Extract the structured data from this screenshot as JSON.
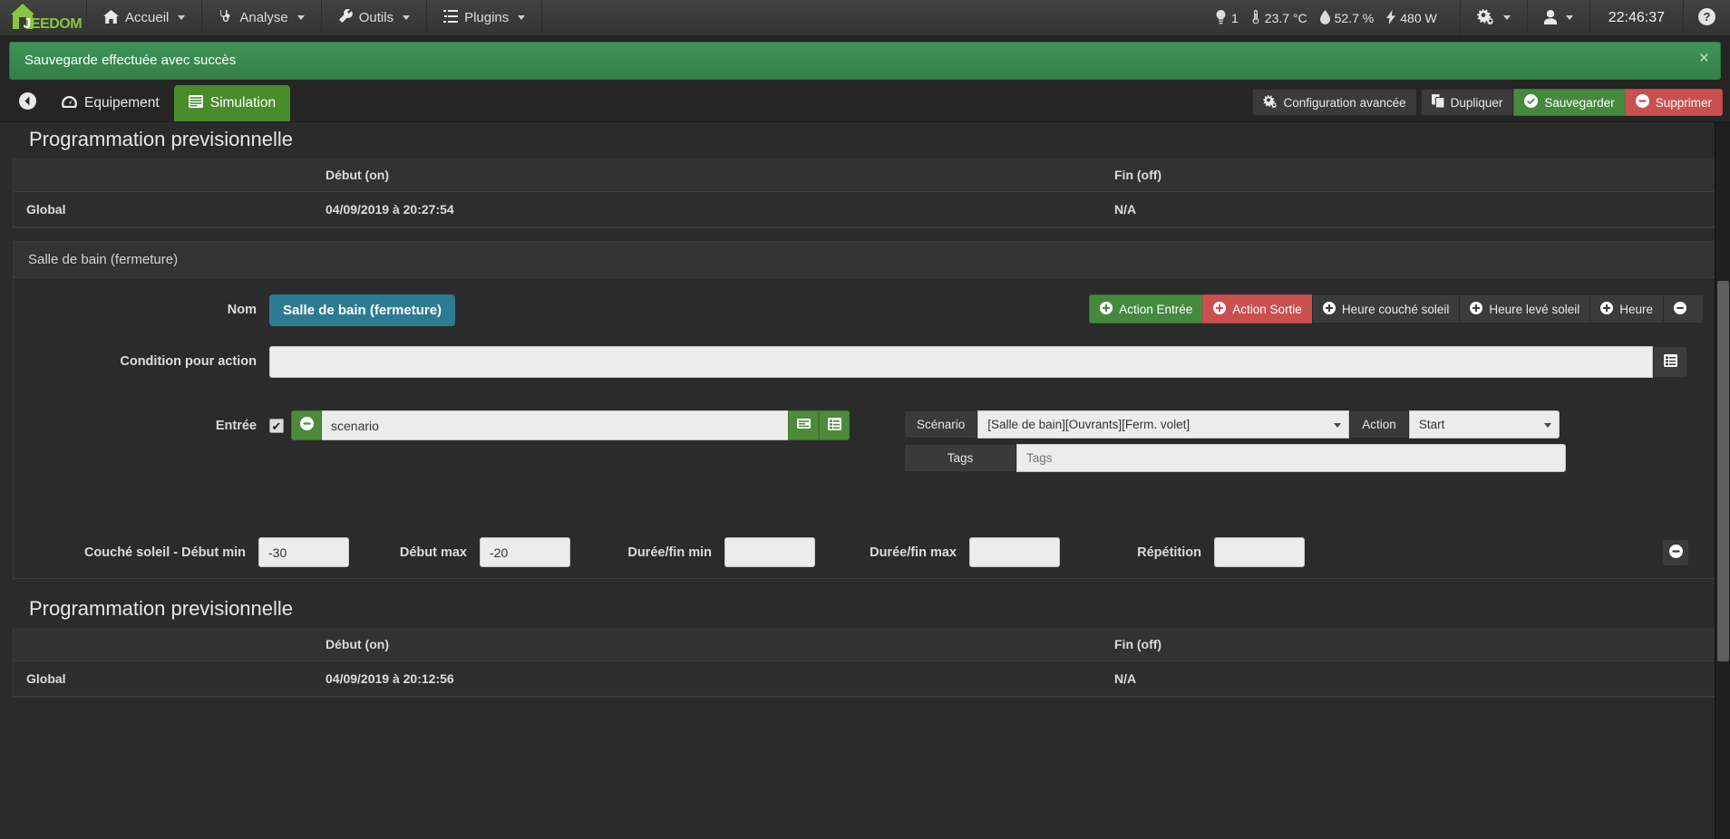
{
  "navbar": {
    "brand": {
      "white": "J",
      "green_1": "EE",
      "green_2": "DOM",
      "full": "JEEDOM"
    },
    "menus": [
      {
        "label": "Accueil",
        "icon": "home-icon"
      },
      {
        "label": "Analyse",
        "icon": "stethoscope-icon"
      },
      {
        "label": "Outils",
        "icon": "wrench-icon"
      },
      {
        "label": "Plugins",
        "icon": "list-icon"
      }
    ],
    "summary": [
      {
        "icon": "lightbulb-icon",
        "value": "1"
      },
      {
        "icon": "thermometer-icon",
        "value": "23.7 °C"
      },
      {
        "icon": "humidity-icon",
        "value": "52.7 %"
      },
      {
        "icon": "bolt-icon",
        "value": "480 W"
      }
    ],
    "gear_icon": "gears-icon",
    "user_icon": "user-icon",
    "clock": "22:46:37",
    "help_icon": "question-circle-icon"
  },
  "alert": {
    "message": "Sauvegarde effectuée avec succès",
    "close_label": "×",
    "color": "#3b8c51"
  },
  "tabbar": {
    "back_icon": "arrow-circle-left-icon",
    "tabs": [
      {
        "label": "Equipement",
        "icon": "dashboard-icon",
        "active": false
      },
      {
        "label": "Simulation",
        "icon": "table-icon",
        "active": true
      }
    ],
    "actions": [
      {
        "label": "Configuration avancée",
        "icon": "cogs-icon",
        "style": "default"
      },
      {
        "label": "Dupliquer",
        "icon": "copy-icon",
        "style": "default"
      },
      {
        "label": "Sauvegarder",
        "icon": "check-circle-icon",
        "style": "success"
      },
      {
        "label": "Supprimer",
        "icon": "minus-circle-icon",
        "style": "danger"
      }
    ]
  },
  "prog_top": {
    "title": "Programmation previsionnelle",
    "headers": [
      "",
      "Début (on)",
      "Fin (off)"
    ],
    "rows": [
      {
        "name": "Global",
        "start": "04/09/2019 à 20:27:54",
        "end": "N/A"
      }
    ]
  },
  "schedule_panel": {
    "header": "Salle de bain (fermeture)",
    "nom": {
      "label": "Nom",
      "value": "Salle de bain (fermeture)"
    },
    "action_buttons": [
      {
        "label": "Action Entrée",
        "icon": "plus-circle-icon",
        "style": "success"
      },
      {
        "label": "Action Sortie",
        "icon": "plus-circle-icon",
        "style": "danger"
      },
      {
        "label": "Heure couché soleil",
        "icon": "plus-circle-icon",
        "style": "default"
      },
      {
        "label": "Heure levé soleil",
        "icon": "plus-circle-icon",
        "style": "default"
      },
      {
        "label": "Heure",
        "icon": "plus-circle-icon",
        "style": "default"
      },
      {
        "label": "",
        "icon": "minus-circle-icon",
        "style": "default"
      }
    ],
    "condition": {
      "label": "Condition pour action",
      "value": "",
      "placeholder": "",
      "addon_icon": "list-alt-icon"
    },
    "entree": {
      "label": "Entrée",
      "checkbox_checked": true,
      "minus_icon": "minus-circle-icon",
      "value": "scenario",
      "addon_1_icon": "keyboard-icon",
      "addon_2_icon": "list-alt-icon"
    },
    "scenario": {
      "label": "Scénario",
      "value": "[Salle de bain][Ouvrants][Ferm. volet]",
      "action_label": "Action",
      "action_value": "Start",
      "tags_label": "Tags",
      "tags_value": "",
      "tags_placeholder": "Tags"
    },
    "timing": {
      "debut_min_label": "Couché soleil - Début min",
      "debut_min_value": "-30",
      "debut_max_label": "Début max",
      "debut_max_value": "-20",
      "duree_fin_min_label": "Durée/fin min",
      "duree_fin_min_value": "",
      "duree_fin_max_label": "Durée/fin max",
      "duree_fin_max_value": "",
      "repetition_label": "Répétition",
      "repetition_value": "",
      "remove_icon": "minus-circle-icon"
    }
  },
  "prog_bottom": {
    "title": "Programmation previsionnelle",
    "headers": [
      "",
      "Début (on)",
      "Fin (off)"
    ],
    "rows": [
      {
        "name": "Global",
        "start": "04/09/2019 à 20:12:56",
        "end": "N/A"
      }
    ]
  }
}
